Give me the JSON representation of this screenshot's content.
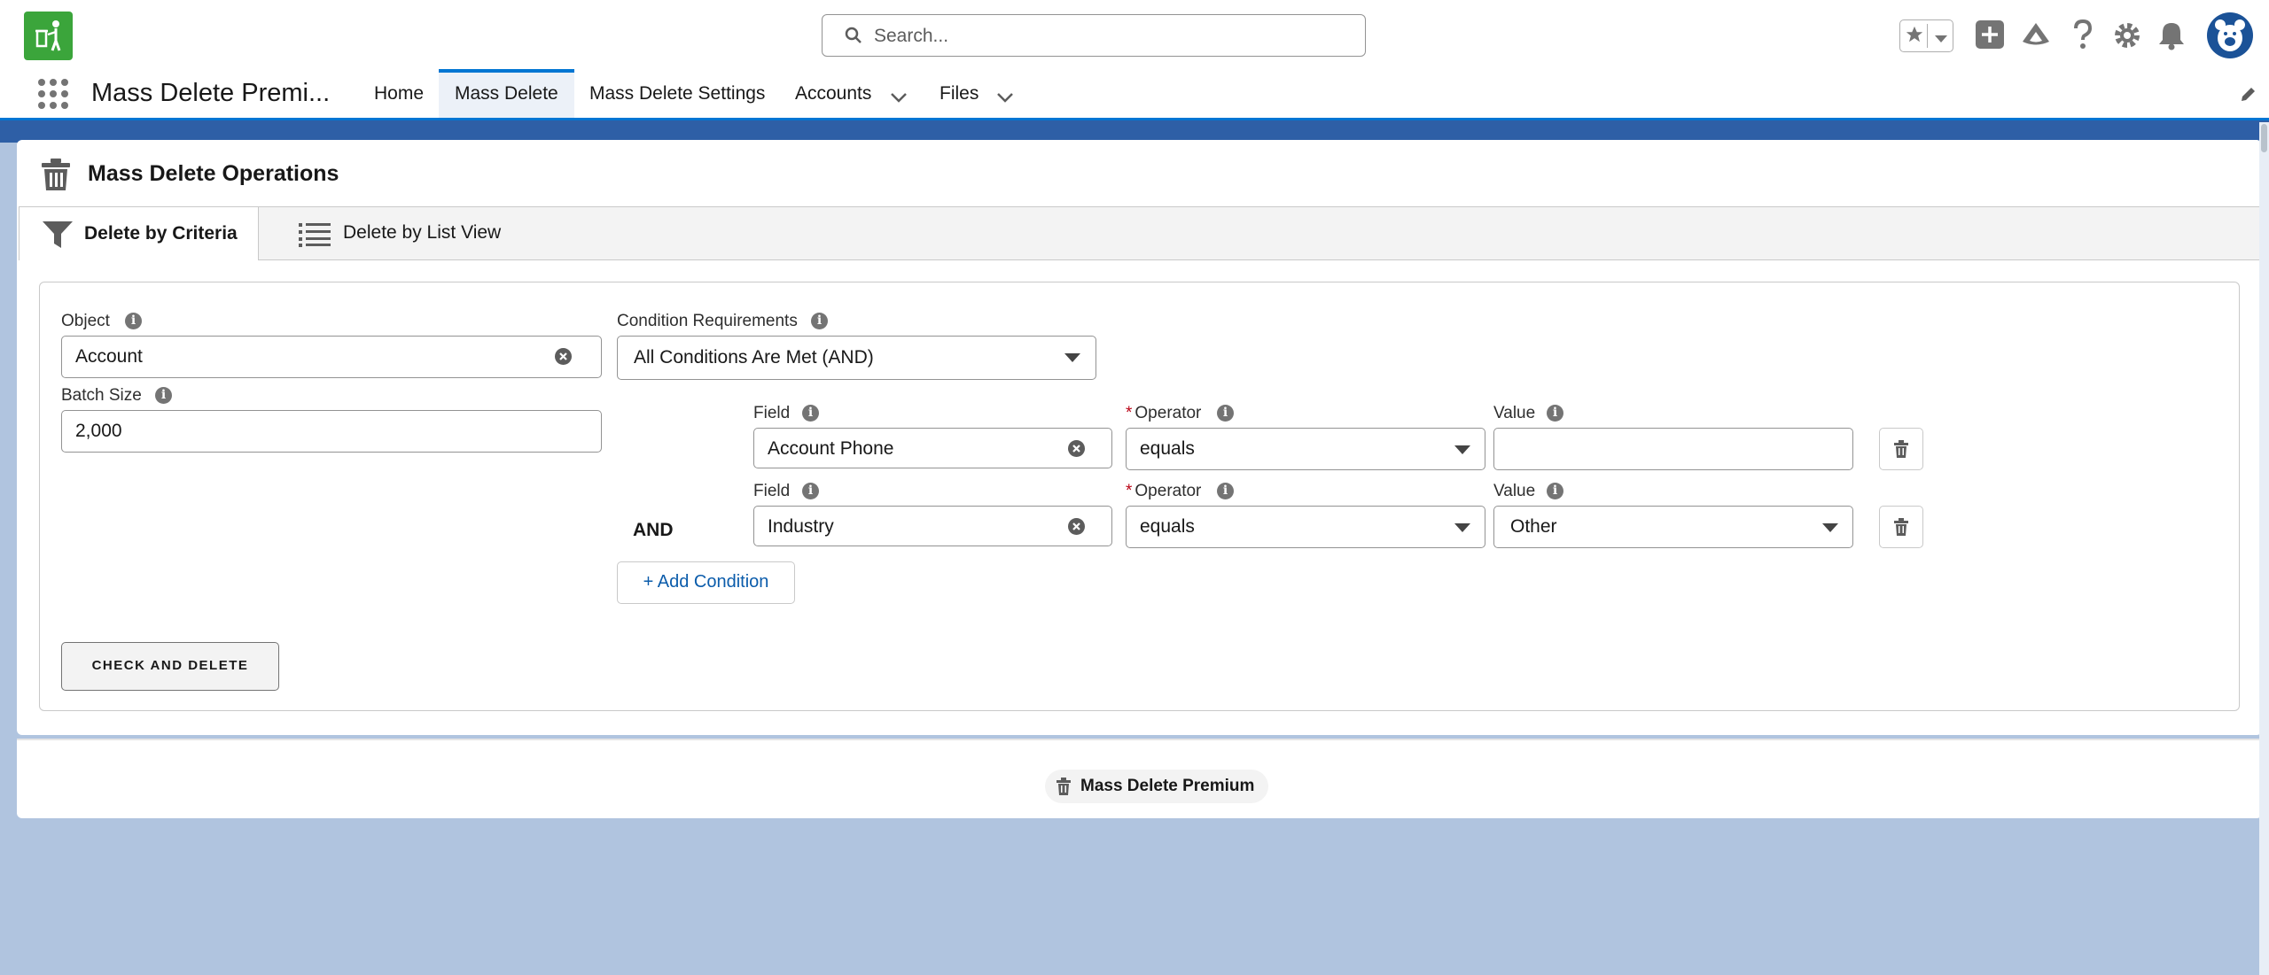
{
  "header": {
    "search_placeholder": "Search...",
    "icons": [
      "app-logo-icon",
      "search-icon",
      "star-icon",
      "chevron-down-icon",
      "add-icon",
      "trailhead-icon",
      "help-icon",
      "gear-icon",
      "bell-icon",
      "avatar"
    ]
  },
  "nav": {
    "app_name": "Mass Delete Premi...",
    "items": [
      {
        "label": "Home",
        "active": false
      },
      {
        "label": "Mass Delete",
        "active": true
      },
      {
        "label": "Mass Delete Settings",
        "active": false
      },
      {
        "label": "Accounts",
        "active": false,
        "dropdown": true
      },
      {
        "label": "Files",
        "active": false,
        "dropdown": true
      }
    ]
  },
  "card": {
    "title": "Mass Delete Operations",
    "tabs": [
      {
        "label": "Delete by Criteria",
        "active": true
      },
      {
        "label": "Delete by List View",
        "active": false
      }
    ]
  },
  "form": {
    "object_label": "Object",
    "object_value": "Account",
    "batch_label": "Batch Size",
    "batch_value": "2,000",
    "condition_req_label": "Condition Requirements",
    "condition_req_value": "All Conditions Are Met (AND)",
    "conditions": [
      {
        "field_label": "Field",
        "field_value": "Account Phone",
        "operator_label": "Operator",
        "operator_value": "equals",
        "value_label": "Value",
        "value_value": ""
      },
      {
        "connector": "AND",
        "field_label": "Field",
        "field_value": "Industry",
        "operator_label": "Operator",
        "operator_value": "equals",
        "value_label": "Value",
        "value_value": "Other"
      }
    ],
    "add_condition_label": "+ Add Condition",
    "check_delete_label": "CHECK AND DELETE"
  },
  "footer": {
    "badge_label": "Mass Delete Premium"
  },
  "colors": {
    "brand_blue": "#0176d3",
    "app_logo_green": "#3ba53b",
    "link_blue": "#0b5cab",
    "required_red": "#ba0517",
    "page_background": "#b0c4df"
  }
}
